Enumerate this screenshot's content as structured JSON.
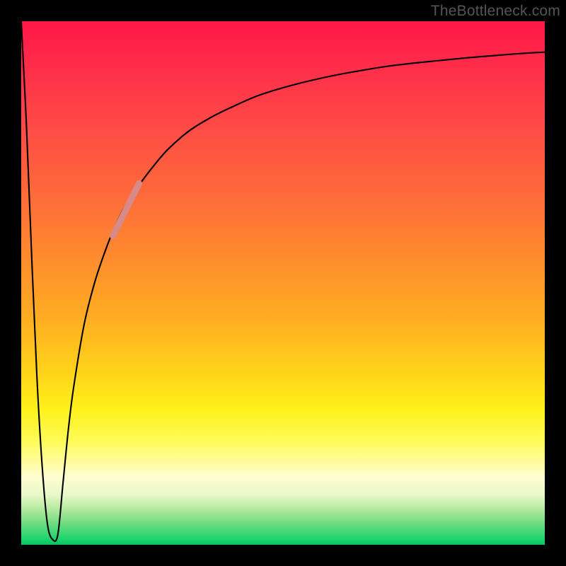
{
  "watermark": "TheBottleneck.com",
  "colors": {
    "frame": "#000000",
    "curve": "#000000",
    "highlight": "#d78a87"
  },
  "chart_data": {
    "type": "line",
    "title": "",
    "xlabel": "",
    "ylabel": "",
    "xlim": [
      0,
      100
    ],
    "ylim": [
      0,
      100
    ],
    "series": [
      {
        "name": "curve",
        "x": [
          0,
          1,
          2,
          3,
          4,
          5,
          6,
          7,
          8,
          9,
          10,
          12,
          14,
          16,
          18,
          20,
          22,
          25,
          28,
          32,
          36,
          40,
          45,
          50,
          55,
          60,
          65,
          70,
          75,
          80,
          85,
          90,
          95,
          100
        ],
        "y": [
          100,
          80,
          55,
          32,
          15,
          4,
          1,
          2,
          12,
          22,
          30,
          42,
          50,
          56,
          61,
          65,
          68,
          72,
          75.5,
          79,
          81.5,
          83.5,
          85.7,
          87.3,
          88.6,
          89.7,
          90.6,
          91.4,
          92.0,
          92.5,
          93.0,
          93.4,
          93.8,
          94.1
        ]
      },
      {
        "name": "highlight-segment",
        "x": [
          17.5,
          22.5
        ],
        "y": [
          59,
          69
        ]
      }
    ],
    "annotations": []
  }
}
